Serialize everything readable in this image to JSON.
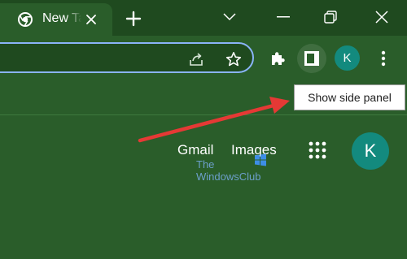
{
  "tab": {
    "title": "New Tab",
    "close_icon": "close-icon",
    "favicon": "chrome-icon"
  },
  "new_tab_icon": "plus-icon",
  "window_controls": [
    "chevron-down-icon",
    "minimize-icon",
    "restore-icon",
    "close-icon"
  ],
  "toolbar": {
    "omnibox_icons": [
      "share-icon",
      "star-icon"
    ],
    "extensions_icon": "puzzle-icon",
    "side_panel_icon": "side-panel-icon",
    "profile_initial": "K",
    "menu_icon": "more-vert-icon"
  },
  "tooltip": {
    "text": "Show side panel"
  },
  "ntp": {
    "gmail_label": "Gmail",
    "images_label": "Images",
    "apps_icon": "apps-grid-icon",
    "profile_initial": "K"
  },
  "watermark": {
    "line1": "The",
    "line2": "WindowsClub"
  },
  "colors": {
    "frame": "#1f4a1f",
    "background": "#2a5d2a",
    "focus_ring": "#8ab4f8",
    "avatar": "#138a7e",
    "annotation_arrow": "#e53935"
  }
}
